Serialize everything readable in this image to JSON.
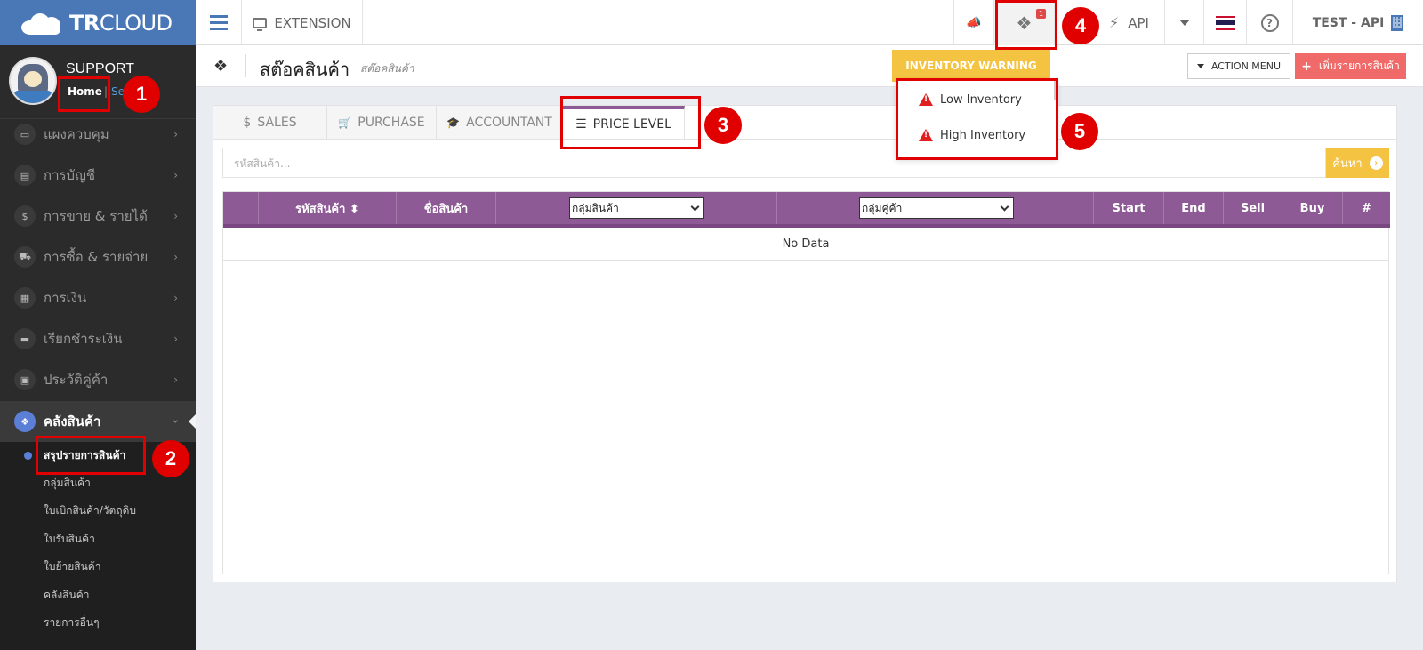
{
  "brand": {
    "bold": "TR",
    "light": "CLOUD"
  },
  "profile": {
    "name": "SUPPORT",
    "home_link": "Home",
    "separator": "|",
    "settings_link": "Se"
  },
  "sidebar": {
    "items": [
      {
        "label": "แผงควบคุม",
        "icon": "desktop-icon",
        "glyph": "▭"
      },
      {
        "label": "การบัญชี",
        "icon": "book-icon",
        "glyph": "▤"
      },
      {
        "label": "การขาย & รายได้",
        "icon": "dollar-icon",
        "glyph": "$"
      },
      {
        "label": "การซื้อ & รายจ่าย",
        "icon": "cart-icon",
        "glyph": "⛟"
      },
      {
        "label": "การเงิน",
        "icon": "calendar-icon",
        "glyph": "▦"
      },
      {
        "label": "เรียกชำระเงิน",
        "icon": "credit-card-icon",
        "glyph": "▬"
      },
      {
        "label": "ประวัติคู่ค้า",
        "icon": "contact-book-icon",
        "glyph": "▣"
      }
    ],
    "active_item": {
      "label": "คลังสินค้า",
      "icon": "cubes-icon",
      "glyph": "❖"
    },
    "sub_items": [
      "สรุปรายการสินค้า",
      "กลุ่มสินค้า",
      "ใบเบิกสินค้า/วัตถุดิบ",
      "ใบรับสินค้า",
      "ใบย้ายสินค้า",
      "คลังสินค้า",
      "รายการอื่นๆ"
    ]
  },
  "topbar": {
    "extension_label": "EXTENSION",
    "inventory_badge": "1",
    "api_label": "API",
    "user_label": "TEST - API",
    "help_glyph": "?"
  },
  "page": {
    "title": "สต๊อคสินค้า",
    "subtitle": "สต๊อคสินค้า",
    "inventory_warning_label": "INVENTORY WARNING",
    "action_menu_label": "ACTION MENU",
    "add_product_label": "เพิ่มรายการสินค้า"
  },
  "inventory_dropdown": {
    "items": [
      "Low Inventory",
      "High Inventory"
    ]
  },
  "tabs": [
    {
      "label": "SALES",
      "glyph": "$"
    },
    {
      "label": "PURCHASE",
      "glyph": "🛒"
    },
    {
      "label": "ACCOUNTANT",
      "glyph": "🎓"
    },
    {
      "label": "PRICE LEVEL",
      "glyph": "☰"
    }
  ],
  "search": {
    "placeholder": "รหัสสินค้า...",
    "button_label": "ค้นหา",
    "button_arrow": "›"
  },
  "table": {
    "columns": {
      "code": "รหัสสินค้า ⬍",
      "name": "ชื่อสินค้า",
      "group_select": "กลุ่มสินค้า",
      "customer_group_select": "กลุ่มคู่ค้า",
      "start": "Start",
      "end": "End",
      "sell": "Sell",
      "buy": "Buy",
      "hash": "#"
    },
    "empty_text": "No Data"
  },
  "annotations": [
    "1",
    "2",
    "3",
    "4",
    "5"
  ],
  "colors": {
    "brand_blue": "#4a78b6",
    "accent_purple": "#8e5a96",
    "warning_yellow": "#f5c342",
    "danger_red": "#f06a6a",
    "annotation_red": "#e00000"
  }
}
